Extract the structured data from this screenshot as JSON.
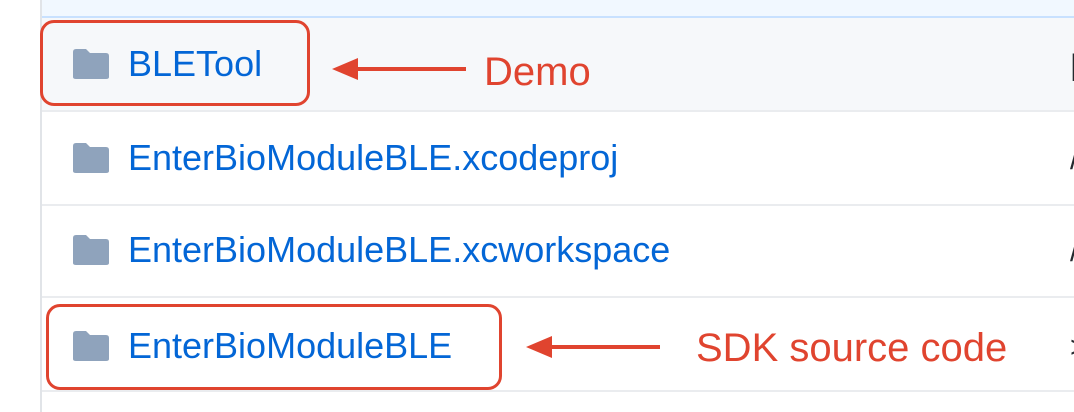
{
  "files": [
    {
      "name": "BLETool",
      "type": "folder",
      "icon": "folder-icon"
    },
    {
      "name": "EnterBioModuleBLE.xcodeproj",
      "type": "folder",
      "icon": "folder-icon"
    },
    {
      "name": "EnterBioModuleBLE.xcworkspace",
      "type": "folder",
      "icon": "folder-icon"
    },
    {
      "name": "EnterBioModuleBLE",
      "type": "folder",
      "icon": "folder-icon"
    }
  ],
  "annotations": {
    "demo_label": "Demo",
    "sdk_label": "SDK source code"
  },
  "colors": {
    "link": "#0366d6",
    "folder_icon": "#8fa3bc",
    "annotation": "#e0442f",
    "row_highlight": "#f6f8fa",
    "divider": "#eaecef"
  }
}
